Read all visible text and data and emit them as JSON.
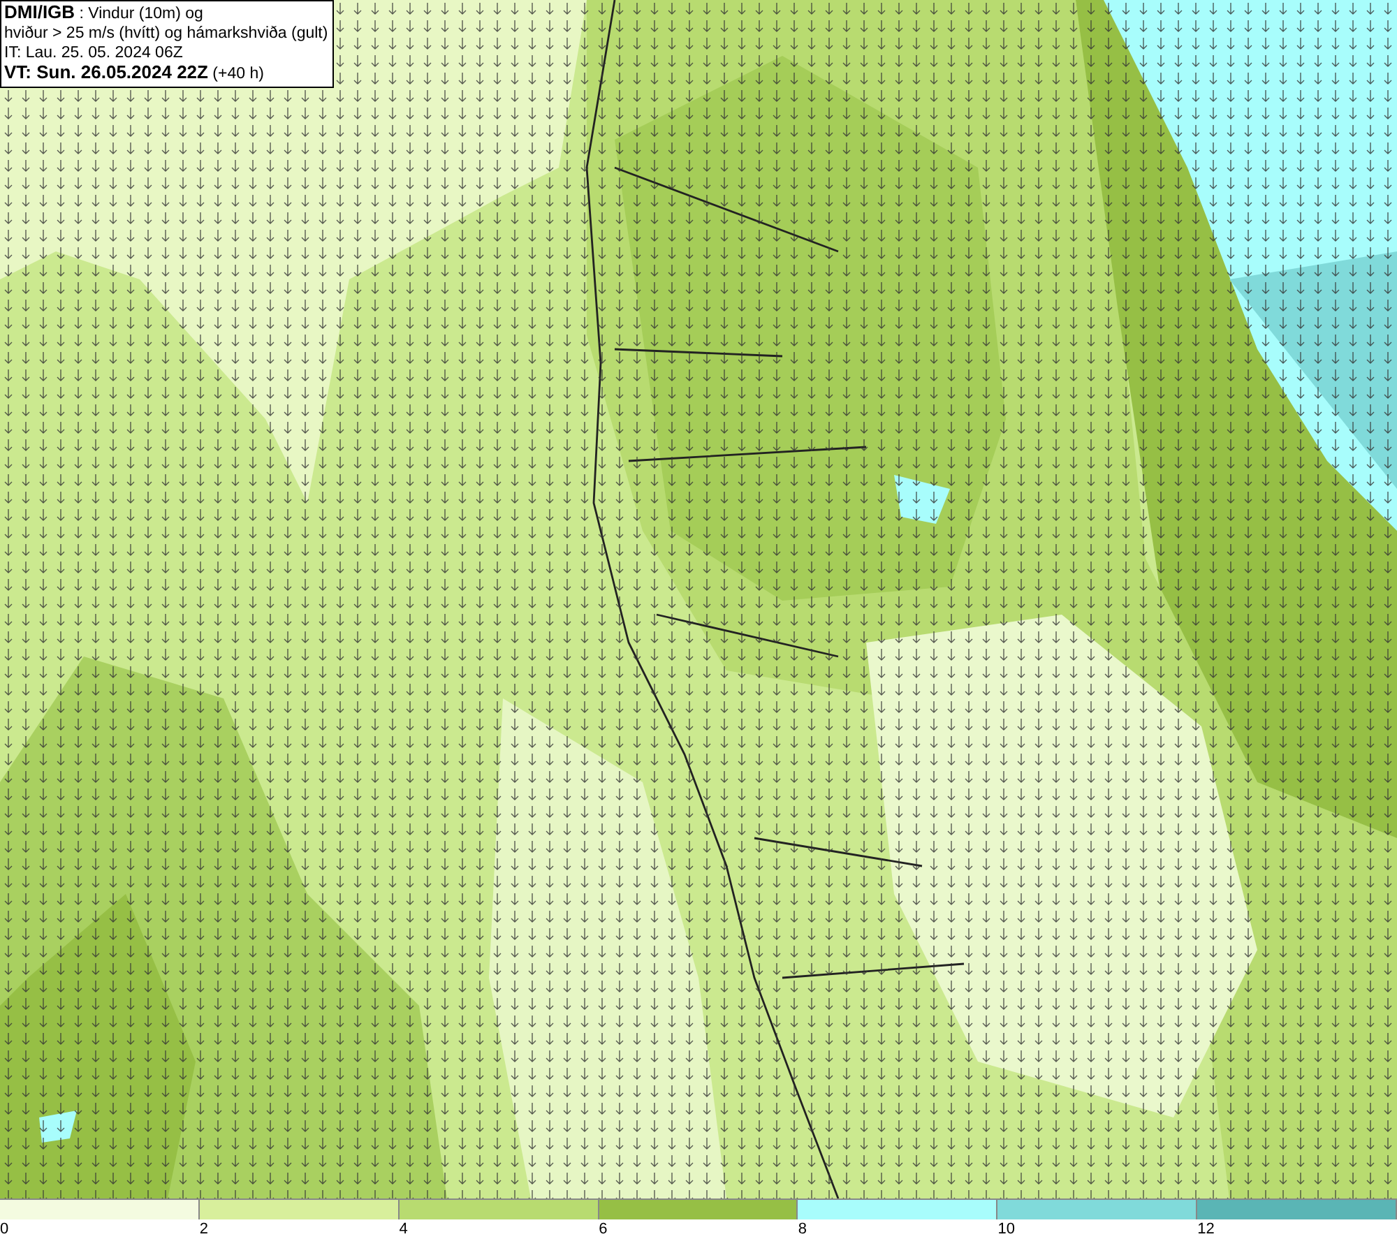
{
  "title_box": {
    "lines": [
      "**DMI/IGB** : Vindur (10m) og",
      "hviður > 25 m/s (hvítt) og hámarkshviða (gult)",
      "IT: Lau. 25. 05. 2024 06Z",
      "**VT: Sun. 26.05.2024 22Z** (+40 h)"
    ]
  },
  "legend": {
    "bins": [
      {
        "label": "0",
        "color": "#f4fbe0"
      },
      {
        "label": "2",
        "color": "#d8ef9c"
      },
      {
        "label": "4",
        "color": "#b8db70"
      },
      {
        "label": "6",
        "color": "#96bf45"
      },
      {
        "label": "8",
        "color": "#a8fdfc"
      },
      {
        "label": "10",
        "color": "#80dada"
      },
      {
        "label": "12",
        "color": "#5ab5b5"
      }
    ]
  }
}
